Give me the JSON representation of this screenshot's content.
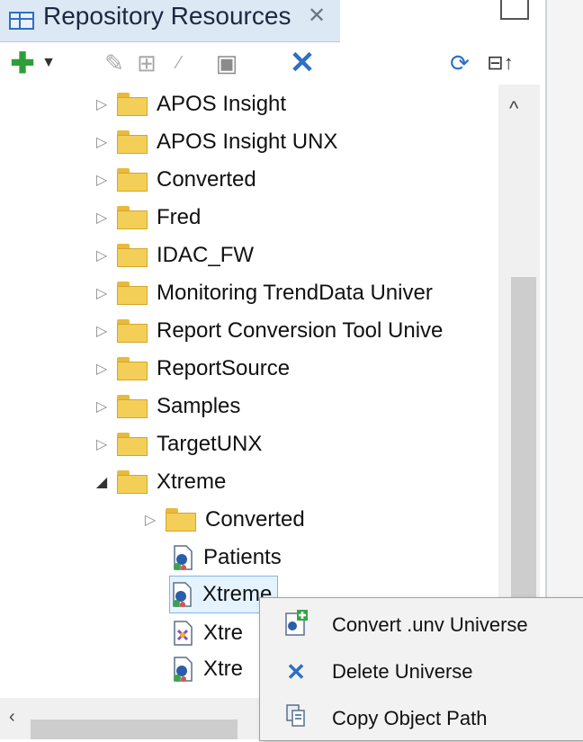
{
  "panel": {
    "title": "Repository Resources",
    "close_glyph": "✕"
  },
  "toolbar": {
    "add_icon": "plus-icon",
    "add_glyph": "✚",
    "dropdown_glyph": "▼",
    "edit_glyph": "✎",
    "table_glyph": "⊞",
    "link_glyph": "⁄",
    "properties_glyph": "▣",
    "delete_glyph": "✕",
    "refresh_glyph": "⟳",
    "collapse_glyph": "⊟↑"
  },
  "tree": {
    "items": [
      {
        "label": "APOS Insight",
        "expanded": false
      },
      {
        "label": "APOS Insight UNX",
        "expanded": false
      },
      {
        "label": "Converted",
        "expanded": false
      },
      {
        "label": "Fred",
        "expanded": false
      },
      {
        "label": "IDAC_FW",
        "expanded": false
      },
      {
        "label": "Monitoring TrendData Univer",
        "expanded": false
      },
      {
        "label": "Report Conversion Tool Unive",
        "expanded": false
      },
      {
        "label": "ReportSource",
        "expanded": false
      },
      {
        "label": "Samples",
        "expanded": false
      },
      {
        "label": "TargetUNX",
        "expanded": false
      },
      {
        "label": "Xtreme",
        "expanded": true
      }
    ],
    "xtreme_children": {
      "folder": {
        "label": "Converted"
      },
      "universes": [
        {
          "label": "Patients"
        },
        {
          "label": "Xtreme",
          "selected": true
        },
        {
          "label": "Xtre"
        },
        {
          "label": "Xtre"
        }
      ]
    }
  },
  "scroll": {
    "up_glyph": "^",
    "left_glyph": "‹"
  },
  "context_menu": {
    "items": [
      {
        "label": "Convert .unv Universe",
        "icon": "convert-universe-icon",
        "glyph": "✚"
      },
      {
        "label": "Delete Universe",
        "icon": "delete-icon",
        "glyph": "✕"
      },
      {
        "label": "Copy Object Path",
        "icon": "copy-icon",
        "glyph": "⧉"
      }
    ]
  },
  "colors": {
    "accent": "#2d6fc4",
    "folder": "#f3cf58",
    "add": "#2f9e3a",
    "selection_border": "#7eb4ea"
  }
}
